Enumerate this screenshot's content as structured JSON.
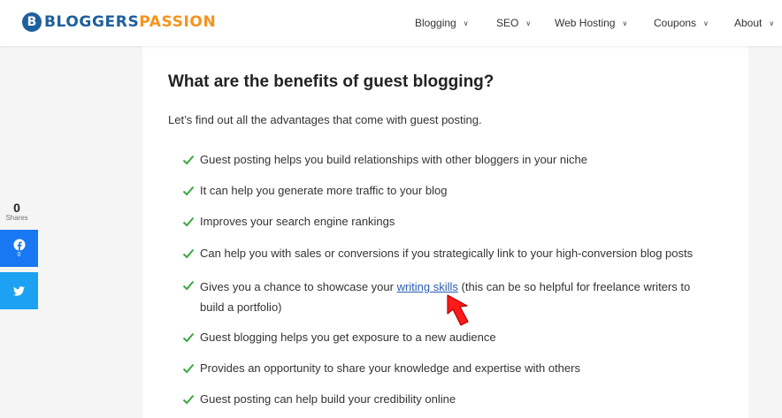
{
  "brand": {
    "mark": "B",
    "name_part1": "BLOGGERS",
    "name_part2": "PASSION",
    "color_primary": "#1f5f9c",
    "color_accent": "#f7931e"
  },
  "nav": [
    {
      "label": "Blogging"
    },
    {
      "label": "SEO"
    },
    {
      "label": "Web Hosting"
    },
    {
      "label": "Coupons"
    },
    {
      "label": "About"
    }
  ],
  "article": {
    "heading": "What are the benefits of guest blogging?",
    "intro": "Let’s find out all the advantages that come with guest posting.",
    "items": [
      {
        "text": "Guest posting helps you build relationships with other bloggers in your niche"
      },
      {
        "text": "It can help you generate more traffic to your blog"
      },
      {
        "text": "Improves your search engine rankings"
      },
      {
        "text": "Can help you with sales or conversions if you strategically link to your high-conversion blog posts"
      },
      {
        "text_before": "Gives you a chance to showcase your ",
        "link": "writing skills",
        "text_after": " (this can be so helpful for freelance writers to build a portfolio)"
      },
      {
        "text": "Guest blogging helps you get exposure to a new audience"
      },
      {
        "text": "Provides an opportunity to share your knowledge and expertise with others"
      },
      {
        "text": "Guest posting can help build your credibility online"
      }
    ],
    "check_color": "#3aa843",
    "link_color": "#2a5db0"
  },
  "share": {
    "total": "0",
    "label": "Shares",
    "facebook_count": "0",
    "facebook_color": "#1877f2",
    "twitter_color": "#1da1f2"
  },
  "annotation": {
    "arrow_color": "#ff1a1a"
  }
}
